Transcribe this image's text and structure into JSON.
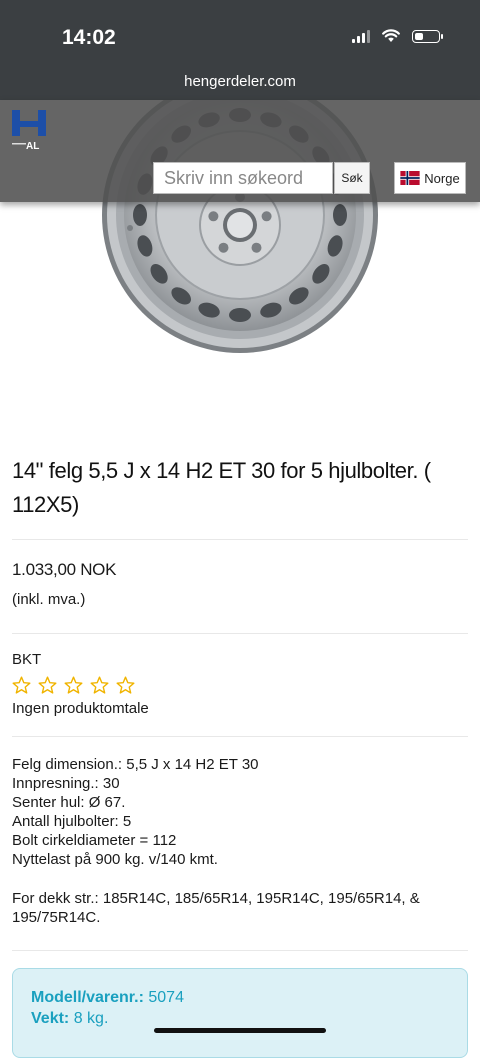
{
  "status": {
    "time": "14:02",
    "battery_level": 0.35
  },
  "browser": {
    "url": "hengerdeler.com"
  },
  "header": {
    "logo_text": "AL",
    "search_placeholder": "Skriv inn søkeord",
    "search_button": "Søk",
    "language": "Norge"
  },
  "product": {
    "title": "14\" felg 5,5 J x 14 H2 ET 30 for 5 hjulbolter. ( 112X5)",
    "price": "1.033,00 NOK",
    "vat_note": "(inkl. mva.)",
    "brand": "BKT",
    "rating": {
      "value": 0,
      "max": 5
    },
    "review_text": "Ingen produktomtale",
    "specs": [
      "Felg dimension.: 5,5 J x 14 H2 ET 30",
      "Innpresning.: 30",
      "Senter hul: Ø 67.",
      "Antall hjulbolter: 5",
      "Bolt cirkeldiameter = 112",
      "Nyttelast på 900 kg. v/140 kmt."
    ],
    "tire_sizes": "For dekk str.: 185R14C, 185/65R14, 195R14C, 195/65R14, & 195/75R14C.",
    "model_label": "Modell/varenr.:",
    "model_value": "5074",
    "weight_label": "Vekt:",
    "weight_value": "8 kg."
  },
  "colors": {
    "accent": "#1aa0bf",
    "star": "#f0b400",
    "header_bg": "#3b3f42"
  }
}
